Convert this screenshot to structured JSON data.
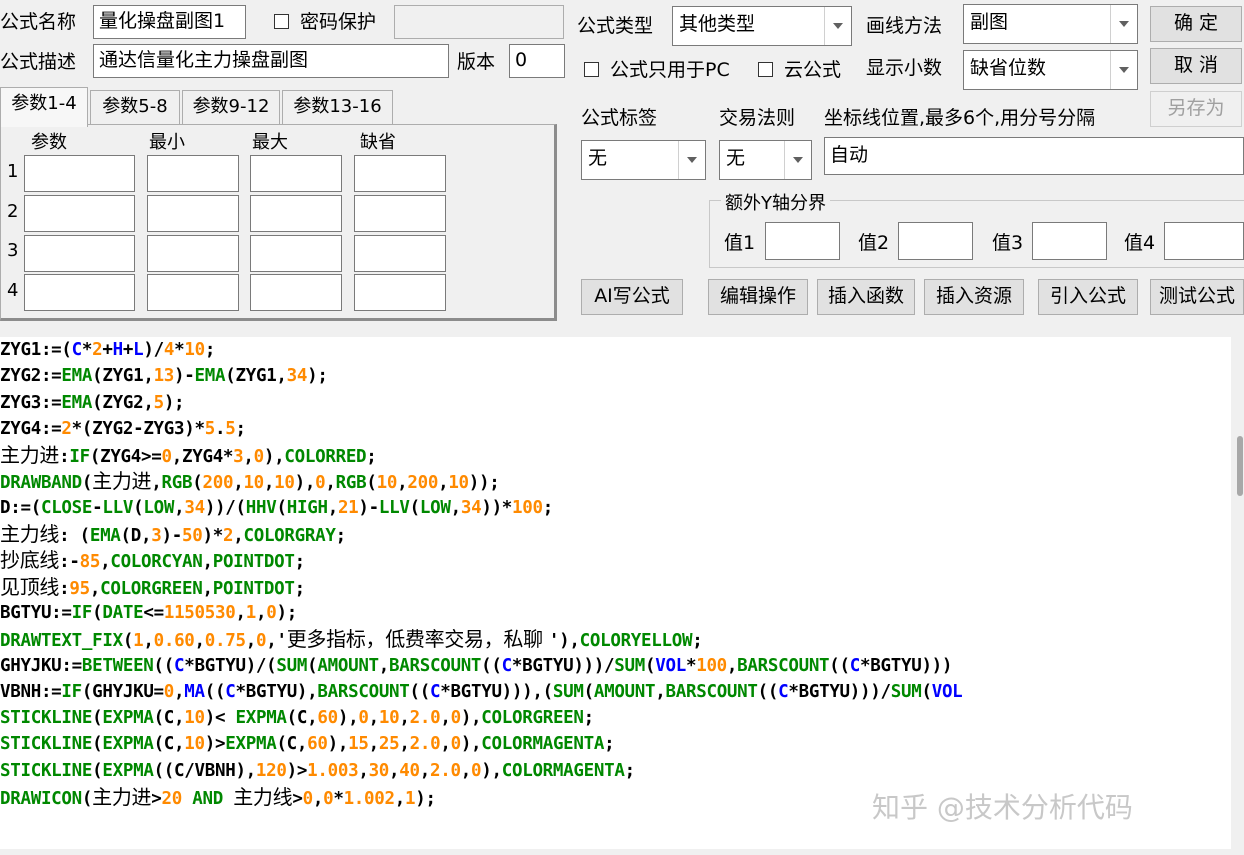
{
  "form": {
    "name_label": "公式名称",
    "name_value": "量化操盘副图1",
    "password_label": "密码保护",
    "password_value": "",
    "desc_label": "公式描述",
    "desc_value": "通达信量化主力操盘副图",
    "version_label": "版本",
    "version_value": "0",
    "type_label": "公式类型",
    "type_value": "其他类型",
    "draw_label": "画线方法",
    "draw_value": "副图",
    "pc_only_label": "公式只用于PC",
    "cloud_label": "云公式",
    "decimal_label": "显示小数",
    "decimal_value": "缺省位数",
    "tag_label": "公式标签",
    "tag_value": "无",
    "rule_label": "交易法则",
    "rule_value": "无",
    "axis_label": "坐标线位置,最多6个,用分号分隔",
    "axis_value": "自动",
    "extra_y_label": "额外Y轴分界",
    "values": [
      {
        "label": "值1",
        "value": ""
      },
      {
        "label": "值2",
        "value": ""
      },
      {
        "label": "值3",
        "value": ""
      },
      {
        "label": "值4",
        "value": ""
      }
    ]
  },
  "buttons": {
    "ok": "确  定",
    "cancel": "取  消",
    "save_as": "另存为",
    "ai": "AI写公式",
    "edit": "编辑操作",
    "insert_func": "插入函数",
    "insert_res": "插入资源",
    "import": "引入公式",
    "test": "测试公式"
  },
  "param_tabs": [
    "参数1-4",
    "参数5-8",
    "参数9-12",
    "参数13-16"
  ],
  "param_headers": [
    "参数",
    "最小",
    "最大",
    "缺省"
  ],
  "param_rows": [
    "1",
    "2",
    "3",
    "4"
  ],
  "code_lines": [
    [
      [
        "k",
        "ZYG1:=("
      ],
      [
        "b",
        "C"
      ],
      [
        "k",
        "*"
      ],
      [
        "n",
        "2"
      ],
      [
        "k",
        "+"
      ],
      [
        "b",
        "H"
      ],
      [
        "k",
        "+"
      ],
      [
        "b",
        "L"
      ],
      [
        "k",
        ")/"
      ],
      [
        "n",
        "4"
      ],
      [
        "k",
        "*"
      ],
      [
        "n",
        "10"
      ],
      [
        "k",
        ";"
      ]
    ],
    [
      [
        "k",
        "ZYG2:="
      ],
      [
        "f",
        "EMA"
      ],
      [
        "k",
        "(ZYG1,"
      ],
      [
        "n",
        "13"
      ],
      [
        "k",
        ")-"
      ],
      [
        "f",
        "EMA"
      ],
      [
        "k",
        "(ZYG1,"
      ],
      [
        "n",
        "34"
      ],
      [
        "k",
        ");"
      ]
    ],
    [
      [
        "k",
        "ZYG3:="
      ],
      [
        "f",
        "EMA"
      ],
      [
        "k",
        "(ZYG2,"
      ],
      [
        "n",
        "5"
      ],
      [
        "k",
        ");"
      ]
    ],
    [
      [
        "k",
        "ZYG4:="
      ],
      [
        "n",
        "2"
      ],
      [
        "k",
        "*(ZYG2-ZYG3)*"
      ],
      [
        "n",
        "5"
      ],
      [
        "k",
        "."
      ],
      [
        "n",
        "5"
      ],
      [
        "k",
        ";"
      ]
    ],
    [
      [
        "cn",
        "主力进"
      ],
      [
        "k",
        ":"
      ],
      [
        "f",
        "IF"
      ],
      [
        "k",
        "(ZYG4>="
      ],
      [
        "n",
        "0"
      ],
      [
        "k",
        ",ZYG4*"
      ],
      [
        "n",
        "3"
      ],
      [
        "k",
        ","
      ],
      [
        "n",
        "0"
      ],
      [
        "k",
        "),"
      ],
      [
        "f",
        "COLORRED"
      ],
      [
        "k",
        ";"
      ]
    ],
    [
      [
        "f",
        "DRAWBAND"
      ],
      [
        "k",
        "("
      ],
      [
        "cn",
        "主力进"
      ],
      [
        "k",
        ","
      ],
      [
        "f",
        "RGB"
      ],
      [
        "k",
        "("
      ],
      [
        "n",
        "200"
      ],
      [
        "k",
        ","
      ],
      [
        "n",
        "10"
      ],
      [
        "k",
        ","
      ],
      [
        "n",
        "10"
      ],
      [
        "k",
        "),"
      ],
      [
        "n",
        "0"
      ],
      [
        "k",
        ","
      ],
      [
        "f",
        "RGB"
      ],
      [
        "k",
        "("
      ],
      [
        "n",
        "10"
      ],
      [
        "k",
        ","
      ],
      [
        "n",
        "200"
      ],
      [
        "k",
        ","
      ],
      [
        "n",
        "10"
      ],
      [
        "k",
        "));"
      ]
    ],
    [
      [
        "k",
        "D:=("
      ],
      [
        "f",
        "CLOSE"
      ],
      [
        "k",
        "-"
      ],
      [
        "f",
        "LLV"
      ],
      [
        "k",
        "("
      ],
      [
        "f",
        "LOW"
      ],
      [
        "k",
        ","
      ],
      [
        "n",
        "34"
      ],
      [
        "k",
        "))/("
      ],
      [
        "f",
        "HHV"
      ],
      [
        "k",
        "("
      ],
      [
        "f",
        "HIGH"
      ],
      [
        "k",
        ","
      ],
      [
        "n",
        "21"
      ],
      [
        "k",
        ")-"
      ],
      [
        "f",
        "LLV"
      ],
      [
        "k",
        "("
      ],
      [
        "f",
        "LOW"
      ],
      [
        "k",
        ","
      ],
      [
        "n",
        "34"
      ],
      [
        "k",
        "))*"
      ],
      [
        "n",
        "100"
      ],
      [
        "k",
        ";"
      ]
    ],
    [
      [
        "cn",
        "主力线"
      ],
      [
        "k",
        ": ("
      ],
      [
        "f",
        "EMA"
      ],
      [
        "k",
        "(D,"
      ],
      [
        "n",
        "3"
      ],
      [
        "k",
        ")-"
      ],
      [
        "n",
        "50"
      ],
      [
        "k",
        ")*"
      ],
      [
        "n",
        "2"
      ],
      [
        "k",
        ","
      ],
      [
        "f",
        "COLORGRAY"
      ],
      [
        "k",
        ";"
      ]
    ],
    [
      [
        "cn",
        "抄底线"
      ],
      [
        "k",
        ":-"
      ],
      [
        "n",
        "85"
      ],
      [
        "k",
        ","
      ],
      [
        "f",
        "COLORCYAN"
      ],
      [
        "k",
        ","
      ],
      [
        "f",
        "POINTDOT"
      ],
      [
        "k",
        ";"
      ]
    ],
    [
      [
        "cn",
        "见顶线"
      ],
      [
        "k",
        ":"
      ],
      [
        "n",
        "95"
      ],
      [
        "k",
        ","
      ],
      [
        "f",
        "COLORGREEN"
      ],
      [
        "k",
        ","
      ],
      [
        "f",
        "POINTDOT"
      ],
      [
        "k",
        ";"
      ]
    ],
    [
      [
        "k",
        "BGTYU:="
      ],
      [
        "f",
        "IF"
      ],
      [
        "k",
        "("
      ],
      [
        "f",
        "DATE"
      ],
      [
        "k",
        "<="
      ],
      [
        "n",
        "1150530"
      ],
      [
        "k",
        ","
      ],
      [
        "n",
        "1"
      ],
      [
        "k",
        ","
      ],
      [
        "n",
        "0"
      ],
      [
        "k",
        ");"
      ]
    ],
    [
      [
        "f",
        "DRAWTEXT_FIX"
      ],
      [
        "k",
        "("
      ],
      [
        "n",
        "1"
      ],
      [
        "k",
        ","
      ],
      [
        "n",
        "0.60"
      ],
      [
        "k",
        ","
      ],
      [
        "n",
        "0.75"
      ],
      [
        "k",
        ","
      ],
      [
        "n",
        "0"
      ],
      [
        "k",
        ",'"
      ],
      [
        "cn",
        "更多指标，低费率交易，私聊 "
      ],
      [
        "k",
        "'),"
      ],
      [
        "f",
        "COLORYELLOW"
      ],
      [
        "k",
        ";"
      ]
    ],
    [
      [
        "k",
        "GHYJKU:="
      ],
      [
        "f",
        "BETWEEN"
      ],
      [
        "k",
        "(("
      ],
      [
        "b",
        "C"
      ],
      [
        "k",
        "*BGTYU)/("
      ],
      [
        "f",
        "SUM"
      ],
      [
        "k",
        "("
      ],
      [
        "f",
        "AMOUNT"
      ],
      [
        "k",
        ","
      ],
      [
        "f",
        "BARSCOUNT"
      ],
      [
        "k",
        "(("
      ],
      [
        "b",
        "C"
      ],
      [
        "k",
        "*BGTYU)))/"
      ],
      [
        "f",
        "SUM"
      ],
      [
        "k",
        "("
      ],
      [
        "b",
        "VOL"
      ],
      [
        "k",
        "*"
      ],
      [
        "n",
        "100"
      ],
      [
        "k",
        ","
      ],
      [
        "f",
        "BARSCOUNT"
      ],
      [
        "k",
        "(("
      ],
      [
        "b",
        "C"
      ],
      [
        "k",
        "*BGTYU)))"
      ]
    ],
    [
      [
        "k",
        "VBNH:="
      ],
      [
        "f",
        "IF"
      ],
      [
        "k",
        "(GHYJKU="
      ],
      [
        "n",
        "0"
      ],
      [
        "k",
        ","
      ],
      [
        "b",
        "MA"
      ],
      [
        "k",
        "(("
      ],
      [
        "b",
        "C"
      ],
      [
        "k",
        "*BGTYU),"
      ],
      [
        "f",
        "BARSCOUNT"
      ],
      [
        "k",
        "(("
      ],
      [
        "b",
        "C"
      ],
      [
        "k",
        "*BGTYU))),("
      ],
      [
        "f",
        "SUM"
      ],
      [
        "k",
        "("
      ],
      [
        "f",
        "AMOUNT"
      ],
      [
        "k",
        ","
      ],
      [
        "f",
        "BARSCOUNT"
      ],
      [
        "k",
        "(("
      ],
      [
        "b",
        "C"
      ],
      [
        "k",
        "*BGTYU)))/"
      ],
      [
        "f",
        "SUM"
      ],
      [
        "k",
        "("
      ],
      [
        "b",
        "VOL"
      ]
    ],
    [
      [
        "f",
        "STICKLINE"
      ],
      [
        "k",
        "("
      ],
      [
        "f",
        "EXPMA"
      ],
      [
        "k",
        "(C,"
      ],
      [
        "n",
        "10"
      ],
      [
        "k",
        ")< "
      ],
      [
        "f",
        "EXPMA"
      ],
      [
        "k",
        "(C,"
      ],
      [
        "n",
        "60"
      ],
      [
        "k",
        "),"
      ],
      [
        "n",
        "0"
      ],
      [
        "k",
        ","
      ],
      [
        "n",
        "10"
      ],
      [
        "k",
        ","
      ],
      [
        "n",
        "2.0"
      ],
      [
        "k",
        ","
      ],
      [
        "n",
        "0"
      ],
      [
        "k",
        "),"
      ],
      [
        "f",
        "COLORGREEN"
      ],
      [
        "k",
        ";"
      ]
    ],
    [
      [
        "f",
        "STICKLINE"
      ],
      [
        "k",
        "("
      ],
      [
        "f",
        "EXPMA"
      ],
      [
        "k",
        "(C,"
      ],
      [
        "n",
        "10"
      ],
      [
        "k",
        ")>"
      ],
      [
        "f",
        "EXPMA"
      ],
      [
        "k",
        "(C,"
      ],
      [
        "n",
        "60"
      ],
      [
        "k",
        "),"
      ],
      [
        "n",
        "15"
      ],
      [
        "k",
        ","
      ],
      [
        "n",
        "25"
      ],
      [
        "k",
        ","
      ],
      [
        "n",
        "2.0"
      ],
      [
        "k",
        ","
      ],
      [
        "n",
        "0"
      ],
      [
        "k",
        "),"
      ],
      [
        "f",
        "COLORMAGENTA"
      ],
      [
        "k",
        ";"
      ]
    ],
    [
      [
        "f",
        "STICKLINE"
      ],
      [
        "k",
        "("
      ],
      [
        "f",
        "EXPMA"
      ],
      [
        "k",
        "((C/VBNH),"
      ],
      [
        "n",
        "120"
      ],
      [
        "k",
        ")>"
      ],
      [
        "n",
        "1.003"
      ],
      [
        "k",
        ","
      ],
      [
        "n",
        "30"
      ],
      [
        "k",
        ","
      ],
      [
        "n",
        "40"
      ],
      [
        "k",
        ","
      ],
      [
        "n",
        "2.0"
      ],
      [
        "k",
        ","
      ],
      [
        "n",
        "0"
      ],
      [
        "k",
        "),"
      ],
      [
        "f",
        "COLORMAGENTA"
      ],
      [
        "k",
        ";"
      ]
    ],
    [
      [
        "f",
        "DRAWICON"
      ],
      [
        "k",
        "("
      ],
      [
        "cn",
        "主力进"
      ],
      [
        "k",
        ">"
      ],
      [
        "n",
        "20"
      ],
      [
        "k",
        " "
      ],
      [
        "f",
        "AND"
      ],
      [
        "k",
        " "
      ],
      [
        "cn",
        "主力线"
      ],
      [
        "k",
        ">"
      ],
      [
        "n",
        "0"
      ],
      [
        "k",
        ","
      ],
      [
        "n",
        "0"
      ],
      [
        "k",
        "*"
      ],
      [
        "n",
        "1.002"
      ],
      [
        "k",
        ","
      ],
      [
        "n",
        "1"
      ],
      [
        "k",
        ");"
      ]
    ]
  ],
  "watermark": "知乎 @技术分析代码"
}
